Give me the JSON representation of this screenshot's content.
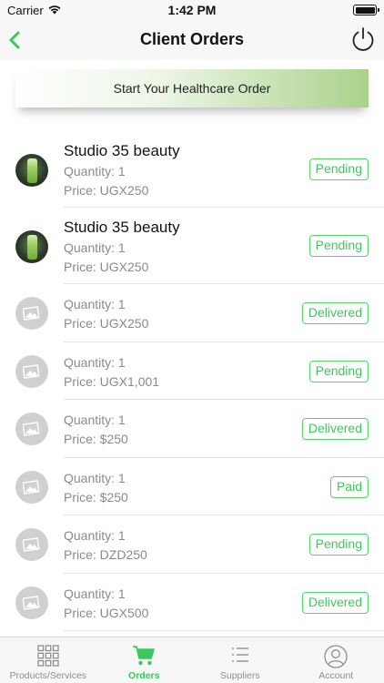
{
  "status_bar": {
    "carrier": "Carrier",
    "time": "1:42 PM"
  },
  "nav": {
    "title": "Client Orders"
  },
  "banner": {
    "label": "Start Your Healthcare Order"
  },
  "orders": [
    {
      "name": "Studio 35 beauty",
      "quantity": "Quantity: 1",
      "price": "Price: UGX250",
      "status": "Pending",
      "image": "product-photo"
    },
    {
      "name": "Studio 35 beauty",
      "quantity": "Quantity: 1",
      "price": "Price: UGX250",
      "status": "Pending",
      "image": "product-photo"
    },
    {
      "name": "",
      "quantity": "Quantity: 1",
      "price": "Price: UGX250",
      "status": "Delivered",
      "image": "image-placeholder-icon"
    },
    {
      "name": "",
      "quantity": "Quantity: 1",
      "price": "Price: UGX1,001",
      "status": "Pending",
      "image": "image-placeholder-icon"
    },
    {
      "name": "",
      "quantity": "Quantity: 1",
      "price": "Price: $250",
      "status": "Delivered",
      "image": "image-placeholder-icon"
    },
    {
      "name": "",
      "quantity": "Quantity: 1",
      "price": "Price: $250",
      "status": "Paid",
      "image": "image-placeholder-icon"
    },
    {
      "name": "",
      "quantity": "Quantity: 1",
      "price": "Price: DZD250",
      "status": "Pending",
      "image": "image-placeholder-icon"
    },
    {
      "name": "",
      "quantity": "Quantity: 1",
      "price": "Price: UGX500",
      "status": "Delivered",
      "image": "image-placeholder-icon"
    }
  ],
  "tabs": [
    {
      "label": "Products/Services",
      "icon": "grid-icon",
      "active": false
    },
    {
      "label": "Orders",
      "icon": "cart-icon",
      "active": true
    },
    {
      "label": "Suppliers",
      "icon": "list-icon",
      "active": false
    },
    {
      "label": "Account",
      "icon": "account-icon",
      "active": false
    }
  ],
  "colors": {
    "accent": "#3cc85a",
    "bar_bg": "#f7f7f7",
    "muted_text": "#8a8a8a"
  }
}
